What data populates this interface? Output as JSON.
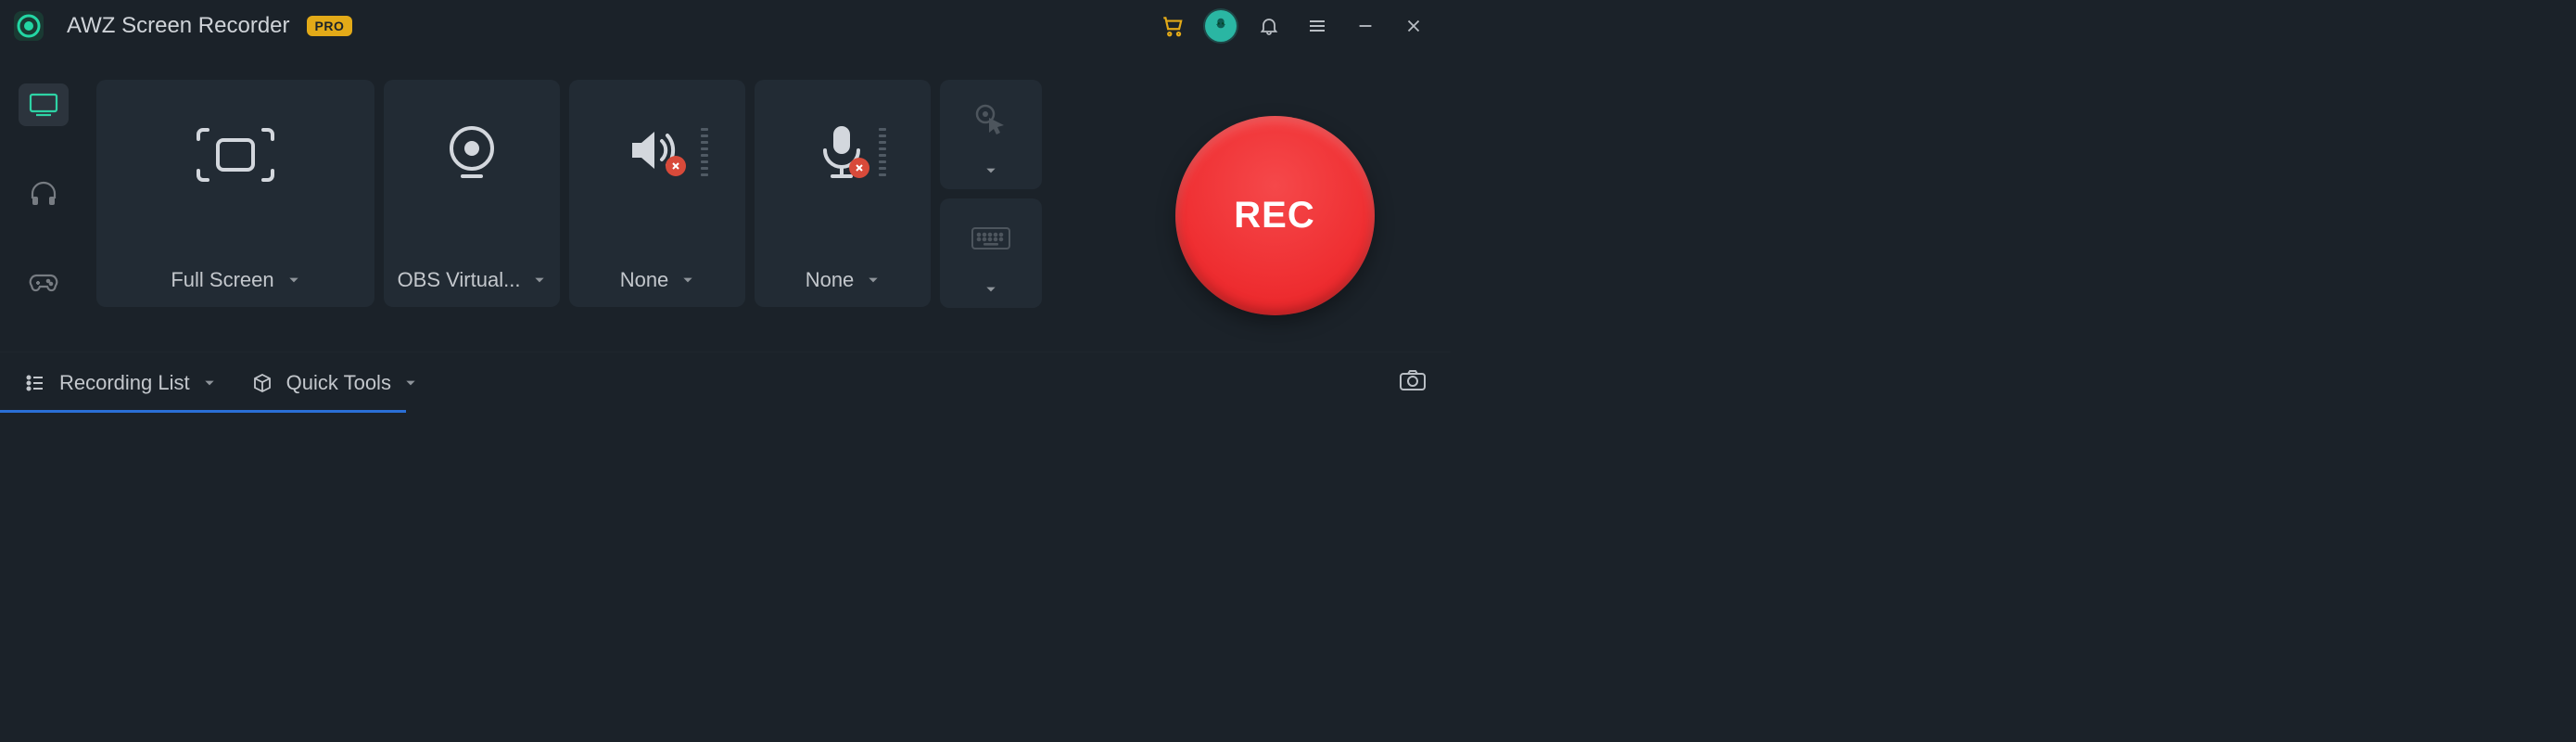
{
  "header": {
    "app_title": "AWZ Screen Recorder",
    "pro_badge": "PRO"
  },
  "sidetabs": [
    {
      "name": "screen",
      "icon": "monitor-icon",
      "active": true
    },
    {
      "name": "audio",
      "icon": "headphones-icon",
      "active": false
    },
    {
      "name": "game",
      "icon": "gamepad-icon",
      "active": false
    }
  ],
  "tiles": {
    "region": {
      "label": "Full Screen"
    },
    "webcam": {
      "label": "OBS Virtual..."
    },
    "speaker": {
      "label": "None",
      "muted": true
    },
    "mic": {
      "label": "None",
      "muted": true
    }
  },
  "small": {
    "top": {
      "icon": "cursor-click-icon"
    },
    "bottom": {
      "icon": "keyboard-icon"
    }
  },
  "rec": {
    "label": "REC"
  },
  "bottombar": {
    "recording_list": "Recording List",
    "quick_tools": "Quick Tools"
  }
}
